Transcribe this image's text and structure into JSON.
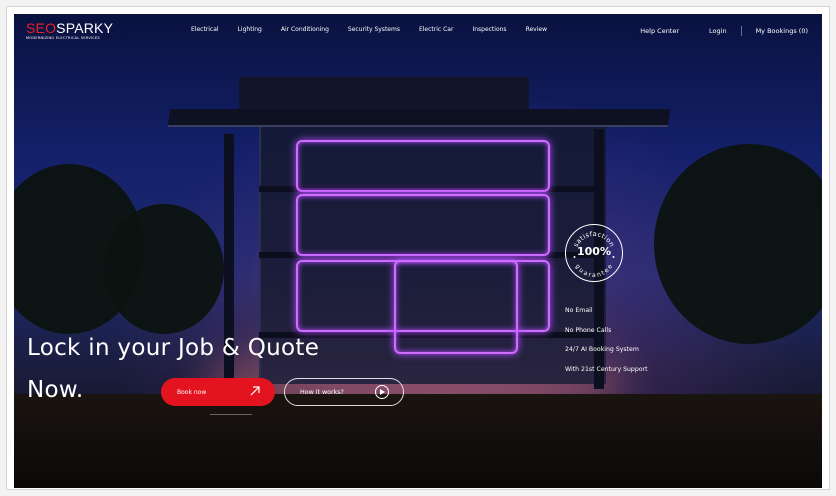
{
  "logo": {
    "brand_red": "SEO",
    "brand_white": "SPARKY",
    "tagline": "MODERNIZING ELECTRICAL SERVICES"
  },
  "nav": {
    "links": [
      "Electrical",
      "Lighting",
      "Air Conditioning",
      "Security Systems",
      "Electric Car",
      "Inspections",
      "Review"
    ],
    "help": "Help Center",
    "login": "Login",
    "bookings": "My Bookings (0)"
  },
  "hero": {
    "headline_line1": "Lock in your Job & Quote",
    "headline_line2": "Now.",
    "book_label": "Book now",
    "how_label": "How it works?"
  },
  "badge": {
    "top_text": "satisfaction",
    "percent": "100%",
    "bottom_text": "guarantee"
  },
  "features": [
    "No Email",
    "No Phone Calls",
    "24/7 AI Booking System",
    "With 21st Century Support"
  ],
  "colors": {
    "accent": "#e3141f",
    "neon": "#d06cff",
    "sky": "#14206a"
  },
  "icons": {
    "book": "arrow-up-right-icon",
    "how": "play-circle-icon"
  }
}
